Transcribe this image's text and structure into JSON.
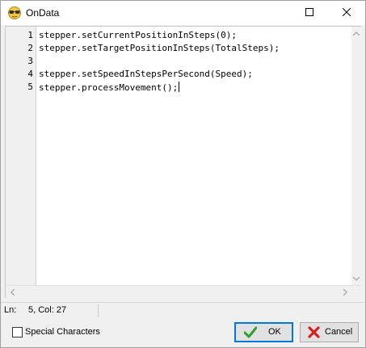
{
  "window": {
    "title": "OnData",
    "app_icon": "glasses-face-icon",
    "maximize_icon": "maximize-icon",
    "close_icon": "close-icon"
  },
  "editor": {
    "line_numbers": [
      "1",
      "2",
      "3",
      "4",
      "5"
    ],
    "lines": [
      "stepper.setCurrentPositionInSteps(0);",
      "stepper.setTargetPositionInSteps(TotalSteps);",
      "",
      "stepper.setSpeedInStepsPerSecond(Speed);",
      "stepper.processMovement();"
    ]
  },
  "status": {
    "ln_label": "Ln:",
    "position": "5, Col: 27"
  },
  "options": {
    "special_characters_label": "Special Characters",
    "special_characters_checked": false
  },
  "buttons": {
    "ok_label": "OK",
    "ok_icon": "checkmark-icon",
    "cancel_label": "Cancel",
    "cancel_icon": "red-x-icon"
  },
  "colors": {
    "accent": "#0078d7",
    "ok_check": "#2e9e2e",
    "cancel_x": "#d42020"
  }
}
